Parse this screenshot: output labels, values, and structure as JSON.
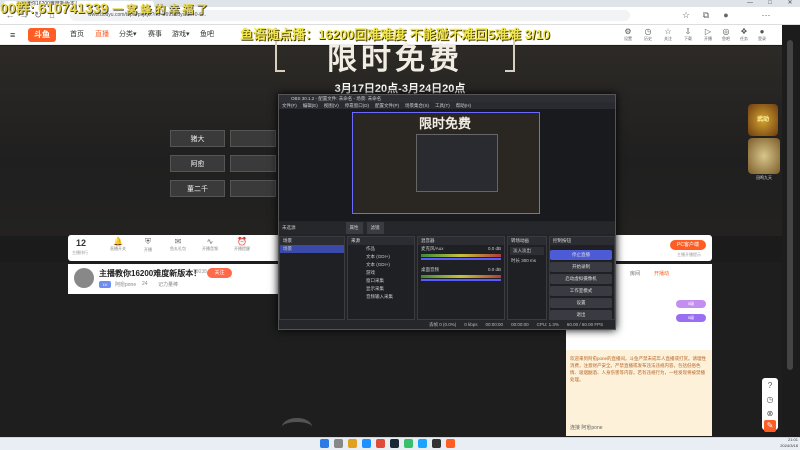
{
  "browser": {
    "tab_title": "主播教你16200难度新版本！",
    "url": "www.douyu.com/topic/psjsyx?rid=9999&dyshid=0-6...",
    "window_controls": [
      "—",
      "□",
      "✕"
    ]
  },
  "overlay": {
    "top_left": "00群: 610741339",
    "top_left_extra": "一 窝 蜂 的 幸 福 了",
    "banner": "鱼语随点播：16200回难难度 不能碰不难回5难难 3/10"
  },
  "site": {
    "logo": "斗鱼",
    "nav": [
      "首页",
      "直播",
      "分类▾",
      "赛事",
      "游戏▾",
      "鱼吧"
    ],
    "header_icons": [
      {
        "icon": "gear-icon",
        "label": "设置"
      },
      {
        "icon": "clock-icon",
        "label": "历史"
      },
      {
        "icon": "star-icon",
        "label": "关注"
      },
      {
        "icon": "download-icon",
        "label": "下载"
      },
      {
        "icon": "play-icon",
        "label": "开播"
      },
      {
        "icon": "pin-icon",
        "label": "鱼吧"
      },
      {
        "icon": "gift-icon",
        "label": "任务"
      },
      {
        "icon": "mail-icon",
        "label": "消息"
      },
      {
        "icon": "user-icon",
        "label": "登录"
      }
    ]
  },
  "promo": {
    "title": "限时免费",
    "date": "3月17日20点-3月24日20点",
    "buttons": [
      "猪大",
      "阿愈",
      "董二千"
    ],
    "side_badge1": "武动",
    "side_badge2_label": "冠鸣九天"
  },
  "room": {
    "rank_number": "12",
    "rank_label": "主播排行",
    "items": [
      {
        "icon": "bell-icon",
        "label": "直播开关"
      },
      {
        "icon": "shield-icon",
        "label": "开播"
      },
      {
        "icon": "gift-icon",
        "label": "鱼丸礼包"
      },
      {
        "icon": "wave-icon",
        "label": "开播音频"
      },
      {
        "icon": "alarm-icon",
        "label": "开播提醒"
      }
    ],
    "pc_button": "PC客户端",
    "pc_sub": "主播开播提示"
  },
  "streamer": {
    "title": "主播教你16200难度新版本！",
    "hot": "18038",
    "follow": "关注",
    "level": "LV",
    "name": "阿愈pone",
    "followers": "24",
    "extra": "记力量棒"
  },
  "chat": {
    "tabs": [
      "贡献榜",
      "粉丝",
      "周榜",
      "房间",
      "开播动"
    ],
    "gift_text": "欢迎来到阿愈pone的直播间。斗鱼严禁未成年人直播或打赏。请理性消费，注意财产安全。严禁直播或发布违法违规内容，包括低俗色情、吸烟酗酒、人身伤害等内容。若有违规行为，一经发现将被禁播处理。",
    "footer_user": "阿愈pone",
    "footer_label": "连接",
    "badge_a": "5级",
    "badge_b": "5级"
  },
  "obs": {
    "title": "OBS 30.1.2 - 配置文件: 未命名 - 场景: 未命名",
    "menu": [
      "文件(F)",
      "编辑(E)",
      "视图(V)",
      "停靠窗口(D)",
      "配置文件(P)",
      "场景集合(S)",
      "工具(T)",
      "帮助(H)"
    ],
    "scene_info_label": "未选源",
    "scene_btn1": "属性",
    "scene_btn2": "滤镜",
    "docks": {
      "scenes": {
        "title": "场景",
        "items": [
          "场景"
        ]
      },
      "sources": {
        "title": "来源",
        "items": [
          "作品",
          "文本 (GDI+)",
          "文本 (GDI+)",
          "游戏",
          "窗口采集",
          "显示采集",
          "音频输入采集"
        ]
      },
      "mixer": {
        "title": "混音器",
        "channels": [
          {
            "name": "麦克风/Aux",
            "db": "0.0 dB"
          },
          {
            "name": "桌面音频",
            "db": "0.0 dB"
          }
        ]
      },
      "transitions": {
        "title": "转场动画",
        "type": "淡入淡出",
        "duration_label": "时长",
        "duration": "300 ms"
      },
      "controls": {
        "title": "控制按钮",
        "buttons": [
          "停止直播",
          "开始录制",
          "启动虚拟摄像机",
          "工作室模式",
          "设置",
          "退出"
        ]
      }
    },
    "status": [
      "丢帧 0 (0.0%)",
      "0 kbps",
      "00:00:00",
      "00:00:00",
      "CPU: 1.3%",
      "60.00 / 60.00 FPS"
    ]
  },
  "taskbar": {
    "time": "21:01",
    "date": "2024/3/18"
  },
  "colors": {
    "brand": "#ff5d23",
    "banner_yellow": "#f0e84a",
    "obs_dark": "#232428"
  }
}
